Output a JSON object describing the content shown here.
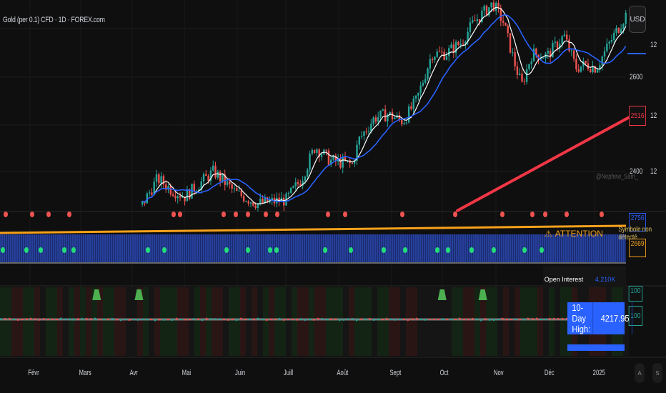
{
  "header": {
    "title": "Gold (per 0.1) CFD · 1D · FOREX.com",
    "currency_button": "USD",
    "watermark": "@Nephew_Sam_"
  },
  "price_axis": {
    "labels": [
      "2600",
      "2400"
    ],
    "side_labels": [
      "12",
      "12",
      "12"
    ],
    "tags": {
      "ma_long": "2516",
      "pane2_top": "2756",
      "pane2_orange": "2669",
      "pane3_a": "100",
      "pane3_b": "100"
    }
  },
  "time_axis": {
    "labels": [
      "Févr",
      "Mars",
      "Avr",
      "Mai",
      "Juin",
      "Juill",
      "Août",
      "Sept",
      "Oct",
      "Nov",
      "Déc",
      "2025"
    ]
  },
  "buttons": {
    "auto": "A",
    "settings": "S"
  },
  "indicators": {
    "attention_label": "ATTENTION",
    "attention_msg": "Symbole non détecté",
    "open_interest": {
      "label": "Open Interest",
      "value": "4.210K"
    },
    "high": {
      "label": "10-Day High:",
      "value": "4217.95"
    }
  },
  "colors": {
    "up": "#26a69a",
    "down": "#ef5350",
    "ma_fast": "#ffffff",
    "ma_mid": "#2962ff",
    "ma_long": "#f23645",
    "orange": "#f7a21b",
    "bg": "#0f0f0f"
  },
  "chart_data": {
    "type": "candlestick",
    "ylim": [
      2317,
      2764
    ],
    "close_path": [
      [
        "2024-04-07",
        2330
      ],
      [
        "2024-04-16",
        2385
      ],
      [
        "2024-04-24",
        2362
      ],
      [
        "2024-05-02",
        2347
      ],
      [
        "2024-05-19",
        2400
      ],
      [
        "2024-06-01",
        2355
      ],
      [
        "2024-06-14",
        2332
      ],
      [
        "2024-07-01",
        2340
      ],
      [
        "2024-07-10",
        2385
      ],
      [
        "2024-07-18",
        2453
      ],
      [
        "2024-07-27",
        2423
      ],
      [
        "2024-08-09",
        2415
      ],
      [
        "2024-08-13",
        2468
      ],
      [
        "2024-08-22",
        2514
      ],
      [
        "2024-08-30",
        2521
      ],
      [
        "2024-09-08",
        2506
      ],
      [
        "2024-09-16",
        2552
      ],
      [
        "2024-09-25",
        2650
      ],
      [
        "2024-10-03",
        2650
      ],
      [
        "2024-10-12",
        2673
      ],
      [
        "2024-10-20",
        2718
      ],
      [
        "2024-10-31",
        2756
      ],
      [
        "2024-11-06",
        2718
      ],
      [
        "2024-11-13",
        2627
      ],
      [
        "2024-11-17",
        2582
      ],
      [
        "2024-11-23",
        2650
      ],
      [
        "2024-12-02",
        2645
      ],
      [
        "2024-12-12",
        2688
      ],
      [
        "2024-12-19",
        2620
      ],
      [
        "2024-12-25",
        2627
      ],
      [
        "2024-12-31",
        2620
      ],
      [
        "2025-01-08",
        2673
      ],
      [
        "2025-01-20",
        2748
      ]
    ],
    "ma_long": [
      [
        "2024-10-10",
        2317
      ],
      [
        "2025-01-20",
        2516
      ]
    ],
    "signal_triangles": [
      "2024-03-11",
      "2024-04-05",
      "2024-10-01",
      "2024-10-25"
    ]
  }
}
